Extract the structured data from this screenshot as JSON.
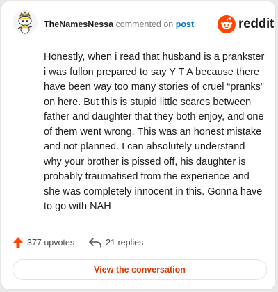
{
  "header": {
    "author": "TheNamesNessa",
    "commented_text": "commented on",
    "post_link": "post",
    "logo_text": "reddit"
  },
  "comment": {
    "body": "Honestly, when i read that husband is a prankster i was fullon prepared to say Y T A because there have been way too many stories of cruel “pranks” on here. But this is stupid little scares between father and daughter that they both enjoy, and one of them went wrong. This was an honest mistake and not planned. I can absolutely understand why your brother is pissed off, his daughter is probably traumatised from the experience and she was completely innocent in this. Gonna have to go with NAH"
  },
  "stats": {
    "upvotes": "377 upvotes",
    "replies": "21 replies"
  },
  "cta": {
    "label": "View the conversation"
  },
  "colors": {
    "brand": "#ff4500",
    "link": "#0079d3",
    "cta_text": "#d93a00"
  },
  "icons": {
    "avatar": "snoo-avatar",
    "logo": "reddit-snoo-icon",
    "upvote": "upvote-arrow-icon",
    "reply": "reply-arrow-icon"
  }
}
